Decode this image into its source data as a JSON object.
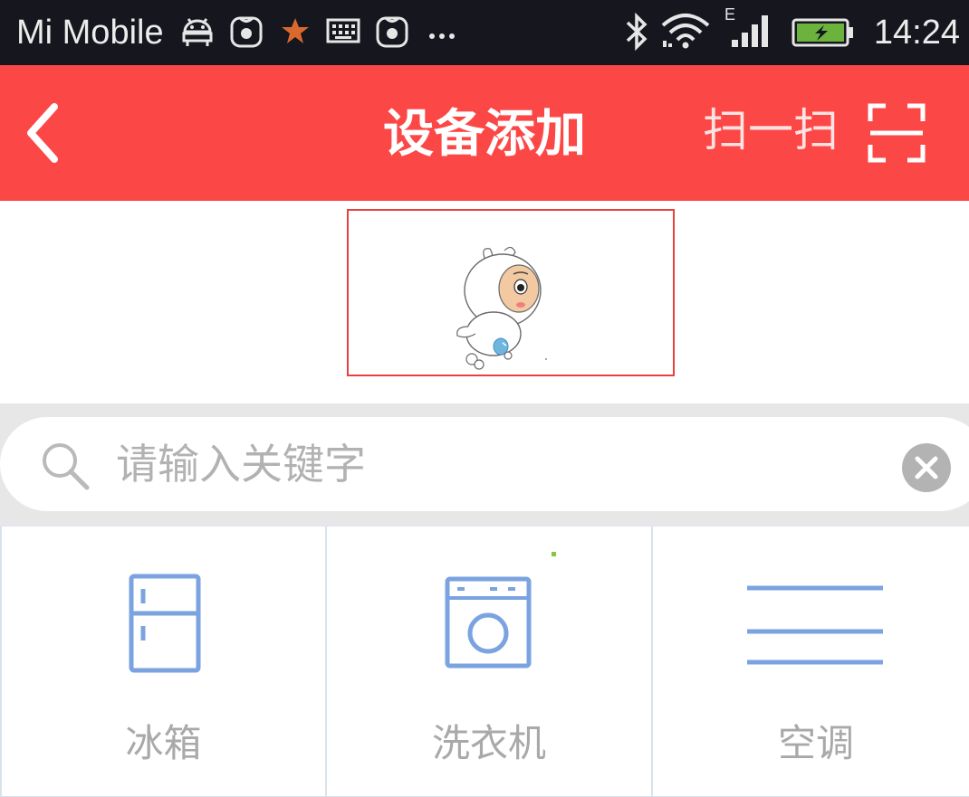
{
  "status_bar": {
    "carrier": "Mi Mobile",
    "time": "14:24",
    "network_type": "E",
    "icons": [
      "android-debug-icon",
      "huawei-app-icon",
      "star-icon",
      "keyboard-icon",
      "huawei-app-icon",
      "more-dots-icon",
      "bluetooth-icon",
      "wifi-icon",
      "signal-icon",
      "battery-charging-icon"
    ]
  },
  "header": {
    "title": "设备添加",
    "back_icon": "chevron-left-icon",
    "scan_label": "扫一扫",
    "scan_icon": "qr-scan-icon",
    "background_color": "#fc4747"
  },
  "banner": {
    "image": "mascot-icon",
    "border_color": "#e84040"
  },
  "search": {
    "placeholder": "请输入关键字",
    "value": "",
    "search_icon": "search-icon",
    "clear_icon": "clear-circle-icon"
  },
  "categories": [
    {
      "label": "冰箱",
      "icon": "refrigerator-icon"
    },
    {
      "label": "洗衣机",
      "icon": "washing-machine-icon"
    },
    {
      "label": "空调",
      "icon": "air-conditioner-icon"
    }
  ],
  "colors": {
    "accent": "#fc4747",
    "icon_blue": "#7aa3e0",
    "label_gray": "#a9a9a9",
    "placeholder_gray": "#b2b2b2"
  }
}
